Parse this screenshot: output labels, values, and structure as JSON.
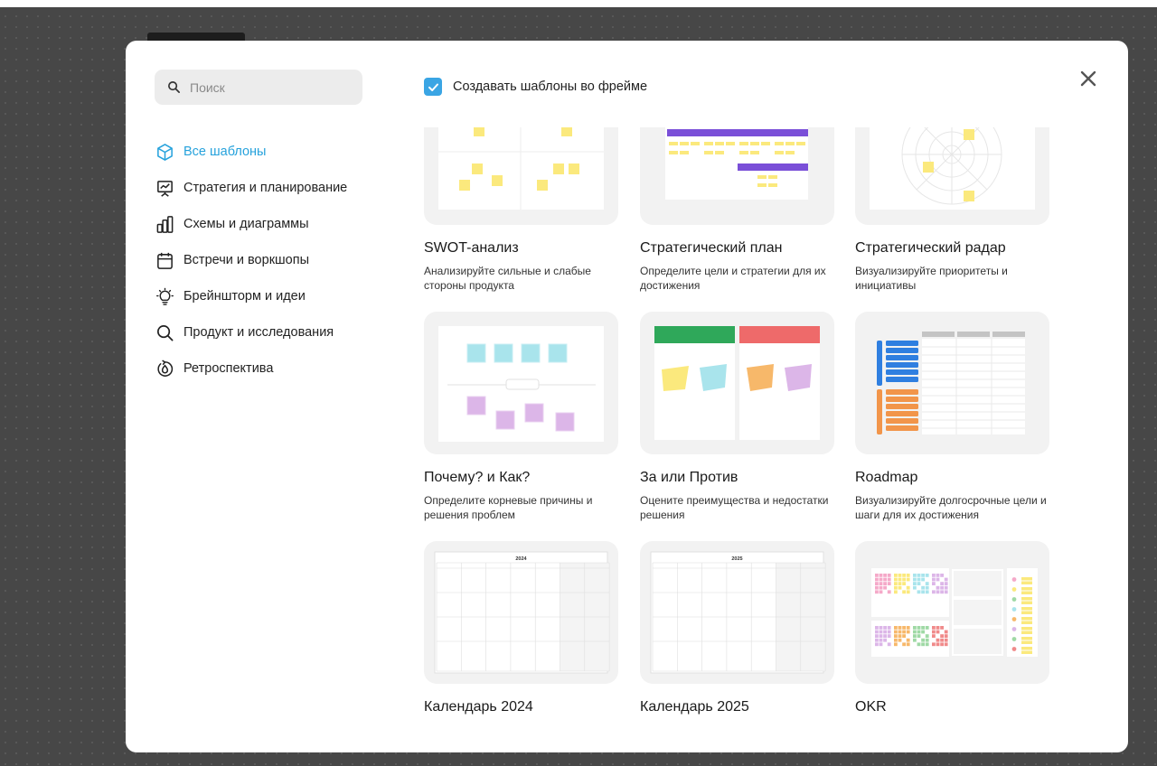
{
  "search": {
    "placeholder": "Поиск"
  },
  "frame_option": {
    "label": "Создавать шаблоны во фрейме",
    "checked": true
  },
  "nav": [
    {
      "label": "Все шаблоны",
      "icon": "cube-icon",
      "active": true
    },
    {
      "label": "Стратегия и планирование",
      "icon": "presentation-chart-icon"
    },
    {
      "label": "Схемы и диаграммы",
      "icon": "bar-chart-icon"
    },
    {
      "label": "Встречи и воркшопы",
      "icon": "calendar-icon"
    },
    {
      "label": "Брейншторм и идеи",
      "icon": "lightbulb-icon"
    },
    {
      "label": "Продукт и исследования",
      "icon": "search-icon"
    },
    {
      "label": "Ретроспектива",
      "icon": "retro-icon"
    }
  ],
  "templates": [
    {
      "title": "SWOT-анализ",
      "desc": "Анализируйте сильные и слабые стороны продукта"
    },
    {
      "title": "Стратегический план",
      "desc": "Определите цели и стратегии для их достижения"
    },
    {
      "title": "Стратегический радар",
      "desc": "Визуализируйте приоритеты и инициативы"
    },
    {
      "title": "Почему? и Как?",
      "desc": "Определите корневые причины и решения проблем"
    },
    {
      "title": "За или Против",
      "desc": "Оцените преимущества и недостатки решения"
    },
    {
      "title": "Roadmap",
      "desc": "Визуализируйте долгосрочные цели и шаги для их достижения"
    },
    {
      "title": "Календарь 2024",
      "desc": "",
      "year": "2024"
    },
    {
      "title": "Календарь 2025",
      "desc": "",
      "year": "2025"
    },
    {
      "title": "OKR",
      "desc": ""
    }
  ],
  "colors": {
    "accent": "#26a2dc",
    "checkbox": "#3aa5e4",
    "sticky_yellow": "#fbe97d",
    "purple": "#7a4fd8",
    "green": "#2fa85a",
    "red": "#ee6a6a",
    "blue": "#2f7fe0",
    "orange": "#f2954a"
  }
}
